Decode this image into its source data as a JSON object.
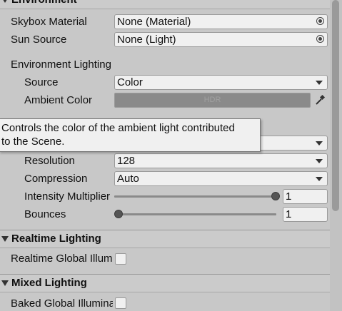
{
  "environment": {
    "header_title": "Environment",
    "skybox_label": "Skybox Material",
    "skybox_value": "None (Material)",
    "sun_label": "Sun Source",
    "sun_value": "None (Light)",
    "env_lighting_label": "Environment Lighting",
    "source_label": "Source",
    "source_value": "Color",
    "ambient_label": "Ambient Color",
    "ambient_hdr": "HDR",
    "ambient_color": "#8a8a8a"
  },
  "tooltip": {
    "line1": "Controls the color of the ambient light contributed",
    "line2": "to the Scene."
  },
  "gi": {
    "resolution_label": "Resolution",
    "resolution_value": "128",
    "compression_label": "Compression",
    "compression_value": "Auto",
    "intensity_label": "Intensity Multiplier",
    "intensity_value": "1",
    "intensity_fraction": 1,
    "bounces_label": "Bounces",
    "bounces_value": "1",
    "bounces_fraction": 0
  },
  "realtime": {
    "header_title": "Realtime Lighting",
    "gi_label": "Realtime Global Illumination",
    "gi_checked": false
  },
  "mixed": {
    "header_title": "Mixed Lighting",
    "baked_label": "Baked Global Illumination",
    "baked_checked": false
  }
}
